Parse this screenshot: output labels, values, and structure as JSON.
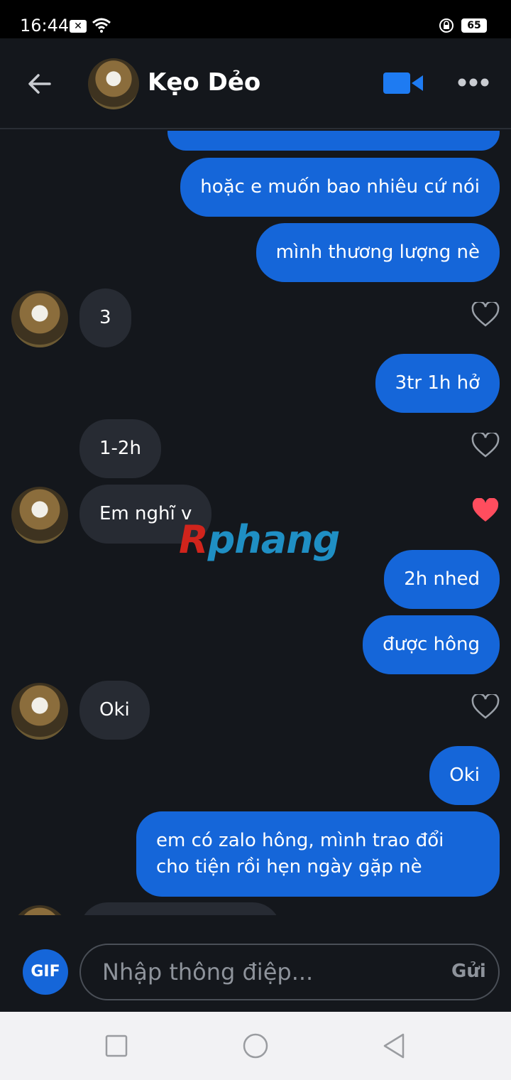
{
  "status": {
    "time": "16:44",
    "battery": "65"
  },
  "header": {
    "contact_name": "Kẹo Dẻo"
  },
  "messages": [
    {
      "id": "m0",
      "text": "hoặc e muốn bao nhiêu cứ nói"
    },
    {
      "id": "m1",
      "text": "mình thương lượng nè"
    },
    {
      "id": "t0",
      "text": "3"
    },
    {
      "id": "m2",
      "text": "3tr 1h hở"
    },
    {
      "id": "t1",
      "text": "1-2h"
    },
    {
      "id": "t2",
      "text": "Em nghĩ v"
    },
    {
      "id": "m3",
      "text": "2h nhed"
    },
    {
      "id": "m4",
      "text": "được hông"
    },
    {
      "id": "t3",
      "text": "Oki"
    },
    {
      "id": "m5",
      "text": "Oki"
    },
    {
      "id": "m6",
      "text": "em có zalo hông, mình trao đổi cho tiện rồi hẹn ngày gặp nè"
    }
  ],
  "watermark": {
    "first": "R",
    "rest": "phang"
  },
  "composer": {
    "gif_label": "GIF",
    "placeholder": "Nhập thông điệp...",
    "send_label": "Gửi"
  },
  "colors": {
    "sent_bubble": "#1566d9",
    "received_bubble": "#272b33",
    "liked_heart": "#ff4d5e"
  }
}
